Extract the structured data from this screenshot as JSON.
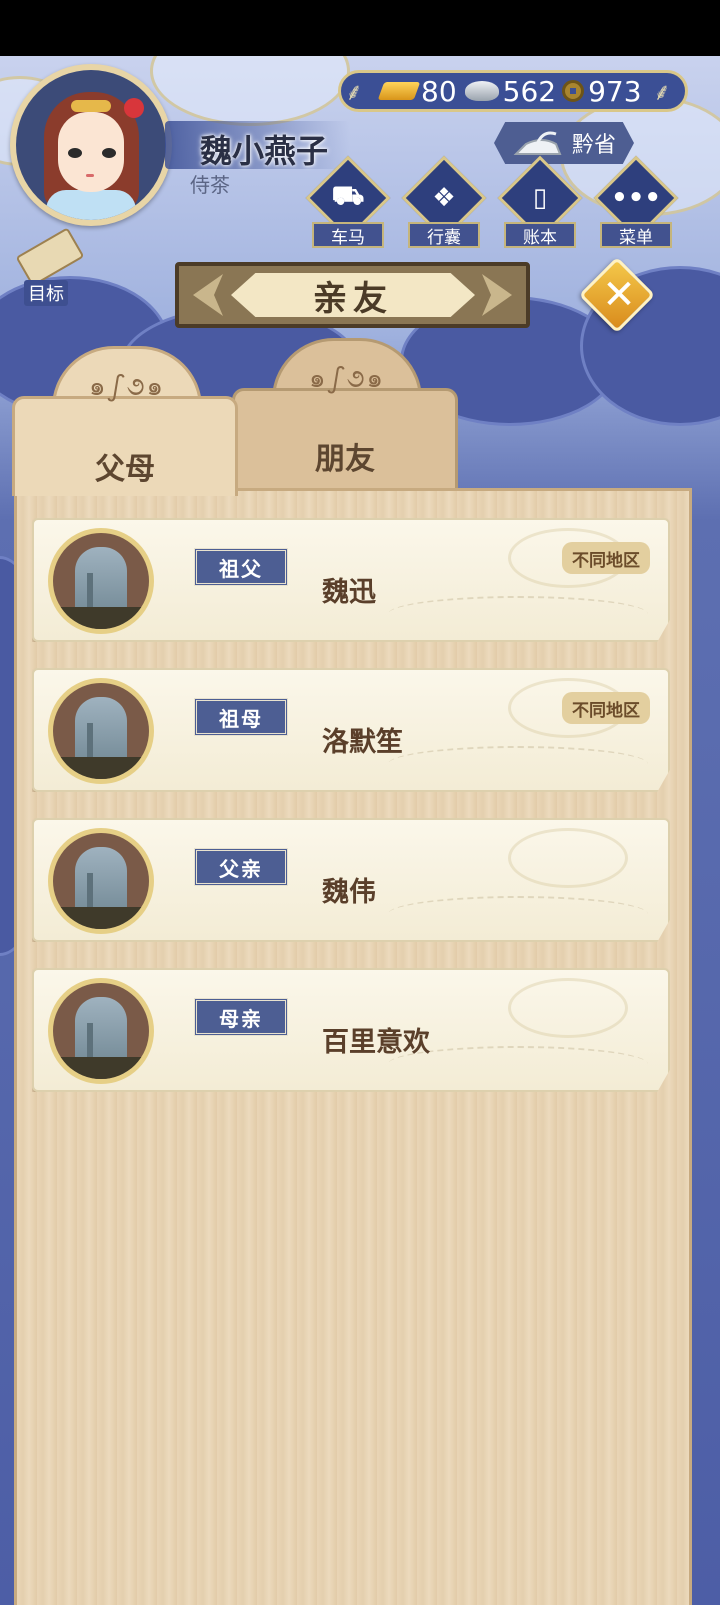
{
  "player": {
    "name": "魏小燕子",
    "title": "侍茶"
  },
  "currency": {
    "gold": "80",
    "silver": "562",
    "coin": "973"
  },
  "region": "黔省",
  "nav": [
    {
      "label": "车马",
      "icon": "carriage-icon"
    },
    {
      "label": "行囊",
      "icon": "bundle-icon"
    },
    {
      "label": "账本",
      "icon": "ledger-icon"
    },
    {
      "label": "菜单",
      "icon": "more-icon"
    }
  ],
  "goal_label": "目标",
  "page_title": "亲友",
  "tabs": [
    {
      "label": "父母",
      "active": true
    },
    {
      "label": "朋友",
      "active": false
    }
  ],
  "relatives": [
    {
      "relation": "祖父",
      "name": "魏迅",
      "region_note": "不同地区"
    },
    {
      "relation": "祖母",
      "name": "洛默笙",
      "region_note": "不同地区"
    },
    {
      "relation": "父亲",
      "name": "魏伟",
      "region_note": ""
    },
    {
      "relation": "母亲",
      "name": "百里意欢",
      "region_note": ""
    }
  ],
  "colors": {
    "sky_top": "#c9d2ee",
    "sky_bottom": "#4d5ea6",
    "panel_wood": "#e9d5b6",
    "badge_blue": "#4d5e93",
    "gold_accent": "#d9c789"
  }
}
